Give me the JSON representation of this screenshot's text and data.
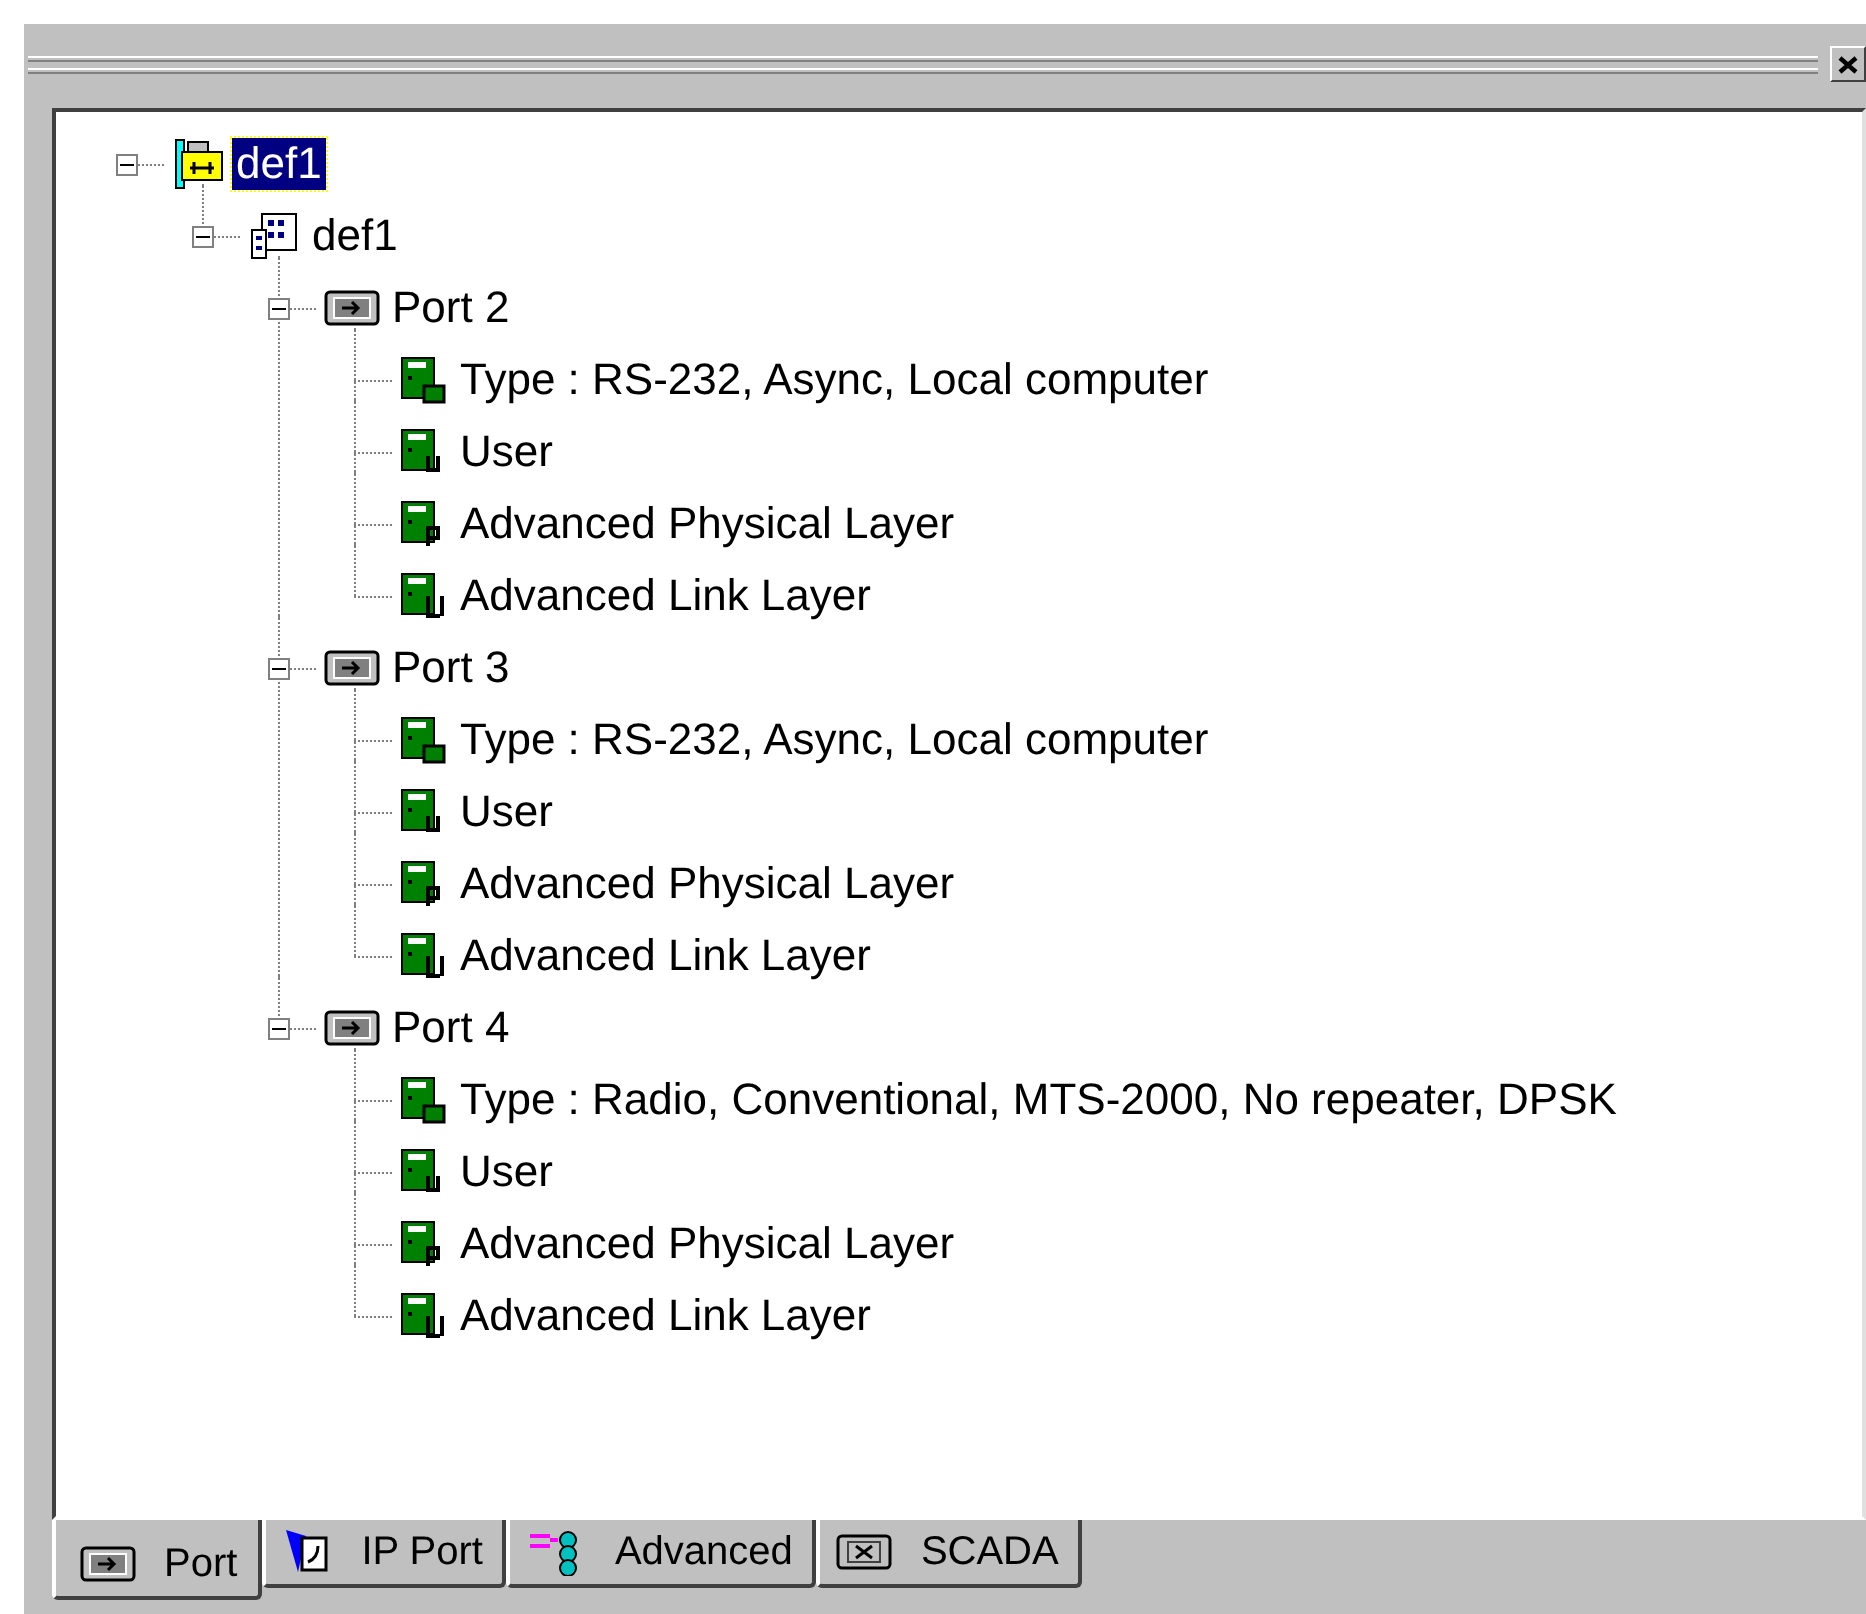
{
  "tree": [
    {
      "label": "def1",
      "kind": "network",
      "selected": true,
      "expanded": true,
      "children": [
        {
          "label": "def1",
          "kind": "station",
          "selected": false,
          "expanded": true,
          "children": [
            {
              "label": "Port 2",
              "kind": "port",
              "selected": false,
              "expanded": true,
              "children": [
                {
                  "label": "Type : RS-232, Async, Local computer",
                  "kind": "type",
                  "selected": false
                },
                {
                  "label": "User",
                  "kind": "user",
                  "selected": false
                },
                {
                  "label": "Advanced Physical Layer",
                  "kind": "physical",
                  "selected": false
                },
                {
                  "label": "Advanced Link Layer",
                  "kind": "link",
                  "selected": false
                }
              ]
            },
            {
              "label": "Port 3",
              "kind": "port",
              "selected": false,
              "expanded": true,
              "children": [
                {
                  "label": "Type : RS-232, Async, Local computer",
                  "kind": "type",
                  "selected": false
                },
                {
                  "label": "User",
                  "kind": "user",
                  "selected": false
                },
                {
                  "label": "Advanced Physical Layer",
                  "kind": "physical",
                  "selected": false
                },
                {
                  "label": "Advanced Link Layer",
                  "kind": "link",
                  "selected": false
                }
              ]
            },
            {
              "label": "Port 4",
              "kind": "port",
              "selected": false,
              "expanded": true,
              "children": [
                {
                  "label": "Type : Radio, Conventional, MTS-2000, No repeater, DPSK",
                  "kind": "type",
                  "selected": false
                },
                {
                  "label": "User",
                  "kind": "user",
                  "selected": false
                },
                {
                  "label": "Advanced Physical Layer",
                  "kind": "physical",
                  "selected": false
                },
                {
                  "label": "Advanced Link Layer",
                  "kind": "link",
                  "selected": false
                }
              ]
            }
          ]
        }
      ]
    }
  ],
  "tabs": [
    {
      "label": "Port",
      "kind": "port",
      "selected": true
    },
    {
      "label": "IP Port",
      "kind": "ip",
      "selected": false
    },
    {
      "label": "Advanced",
      "kind": "advanced",
      "selected": false
    },
    {
      "label": "SCADA",
      "kind": "scada",
      "selected": false
    }
  ]
}
